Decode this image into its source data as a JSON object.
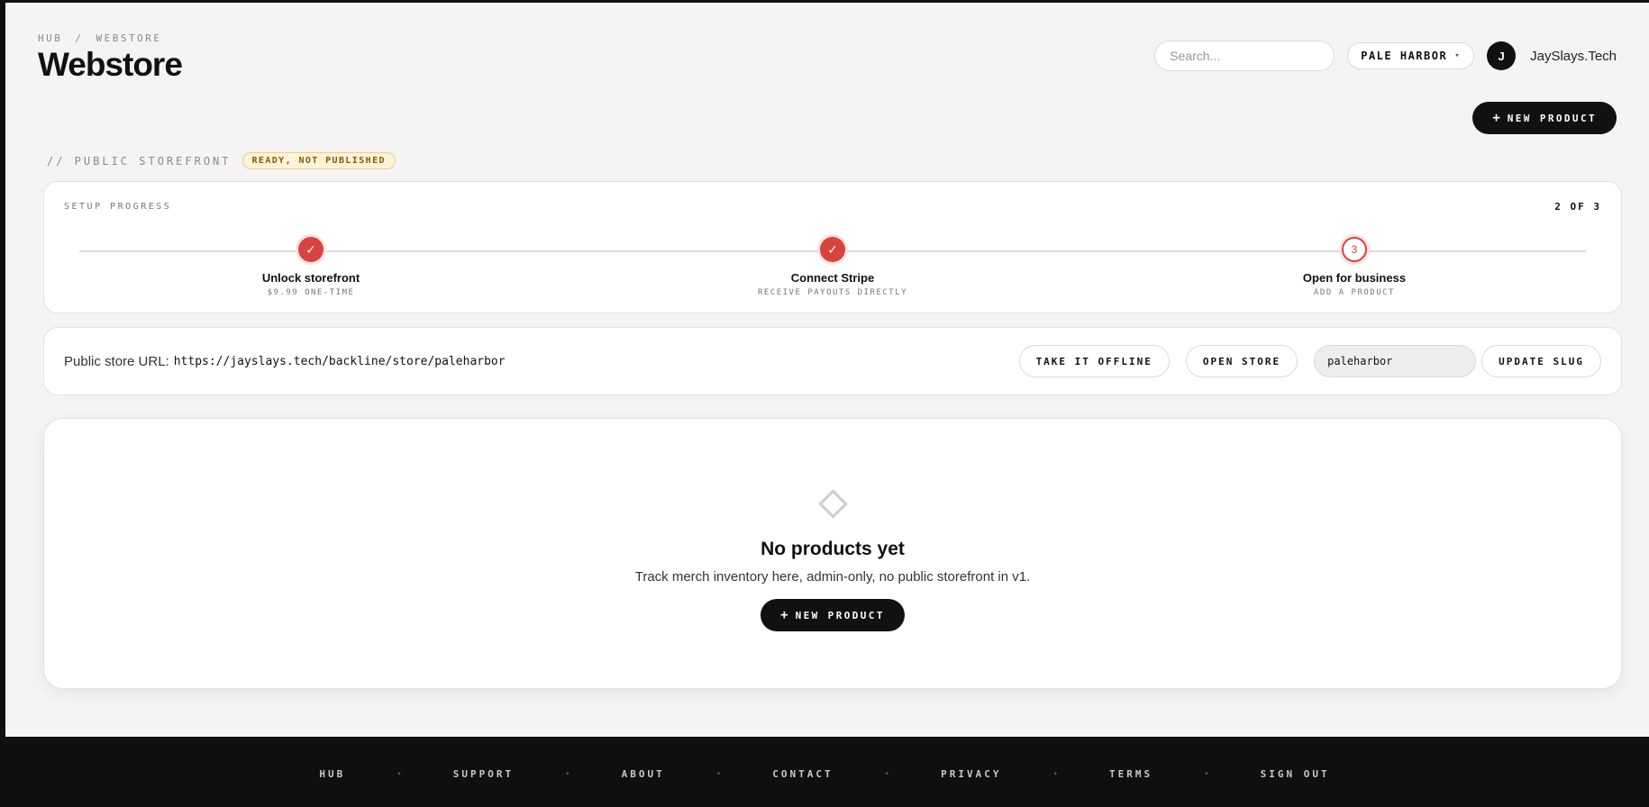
{
  "breadcrumb": {
    "root": "HUB",
    "separator": "/",
    "current": "WEBSTORE"
  },
  "page": {
    "title": "Webstore"
  },
  "header": {
    "search_placeholder": "Search...",
    "org": "PALE HARBOR",
    "org_caret": "▾",
    "avatar_initial": "J",
    "username": "JaySlays.Tech"
  },
  "actions": {
    "new_product_plus": "+",
    "new_product_label": "NEW PRODUCT"
  },
  "section": {
    "label": "// PUBLIC STOREFRONT",
    "status": "READY, NOT PUBLISHED"
  },
  "progress": {
    "title": "SETUP PROGRESS",
    "count": "2 OF 3",
    "completed_fraction": 0.6667,
    "steps": [
      {
        "state": "done",
        "marker": "✓",
        "name": "Unlock storefront",
        "sub": "$9.99 ONE-TIME"
      },
      {
        "state": "done",
        "marker": "✓",
        "name": "Connect Stripe",
        "sub": "RECEIVE PAYOUTS DIRECTLY"
      },
      {
        "state": "pending",
        "marker": "3",
        "name": "Open for business",
        "sub": "ADD A PRODUCT"
      }
    ]
  },
  "store_url": {
    "label": "Public store URL:",
    "value": "https://jayslays.tech/backline/store/paleharbor",
    "offline_label": "TAKE IT OFFLINE",
    "open_label": "OPEN STORE",
    "slug_value": "paleharbor",
    "update_label": "UPDATE SLUG"
  },
  "empty": {
    "title": "No products yet",
    "subtitle": "Track merch inventory here, admin-only, no public storefront in v1.",
    "button_plus": "+",
    "button_label": "NEW PRODUCT"
  },
  "footer": {
    "separator": "•",
    "links": [
      "HUB",
      "SUPPORT",
      "ABOUT",
      "CONTACT",
      "PRIVACY",
      "TERMS",
      "SIGN OUT"
    ]
  },
  "colors": {
    "accent": "#d9433f",
    "dark": "#111111",
    "page_bg": "#f5f4f2",
    "badge_bg": "#fdf3d8"
  }
}
